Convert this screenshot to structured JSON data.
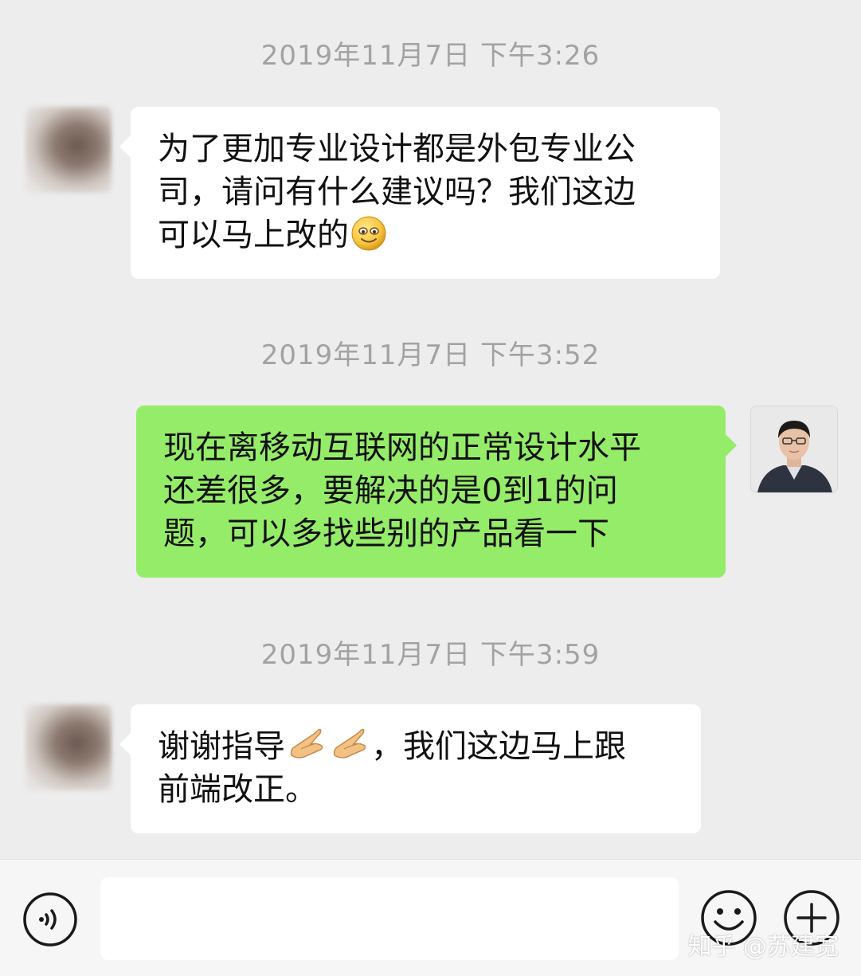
{
  "messages": [
    {
      "timestamp": "2019年11月7日 下午3:26",
      "sender": "other",
      "lines": [
        "为了更加专业设计都是外包专业公",
        "司，请问有什么建议吗？我们这边",
        "可以马上改的"
      ],
      "emoji": "smile-emoji"
    },
    {
      "timestamp": "2019年11月7日 下午3:52",
      "sender": "self",
      "lines": [
        "现在离移动互联网的正常设计水平",
        "还差很多，要解决的是0到1的问",
        "题，可以多找些别的产品看一下"
      ]
    },
    {
      "timestamp": "2019年11月7日 下午3:59",
      "sender": "other",
      "line1_prefix": "谢谢指导",
      "line1_suffix": "，我们这边马上跟",
      "line2": "前端改正。",
      "emoji": "pinched-fingers-emoji"
    }
  ],
  "input": {
    "value": "",
    "placeholder": ""
  },
  "icons": {
    "voice": "voice-icon",
    "emoji": "emoji-icon",
    "plus": "plus-icon"
  },
  "watermark": "知乎 @苏建宽",
  "colors": {
    "background": "#ededed",
    "incoming_bubble": "#ffffff",
    "outgoing_bubble": "#95ec69",
    "timestamp_text": "#a2a2a2"
  }
}
